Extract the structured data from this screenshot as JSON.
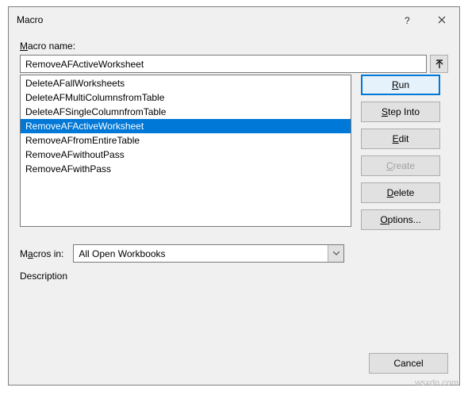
{
  "titlebar": {
    "title": "Macro"
  },
  "labels": {
    "macro_name": "Macro name:",
    "macros_in": "Macros in:",
    "description": "Description"
  },
  "name_input": {
    "value": "RemoveAFActiveWorksheet"
  },
  "list": {
    "items": [
      "DeleteAFallWorksheets",
      "DeleteAFMultiColumnsfromTable",
      "DeleteAFSingleColumnfromTable",
      "RemoveAFActiveWorksheet",
      "RemoveAFfromEntireTable",
      "RemoveAFwithoutPass",
      "RemoveAFwithPass"
    ],
    "selected_index": 3
  },
  "buttons": {
    "run": "Run",
    "step_into": "Step Into",
    "edit": "Edit",
    "create": "Create",
    "delete": "Delete",
    "options": "Options...",
    "cancel": "Cancel"
  },
  "macros_in_select": {
    "value": "All Open Workbooks"
  },
  "watermark": "wsxdn.com"
}
